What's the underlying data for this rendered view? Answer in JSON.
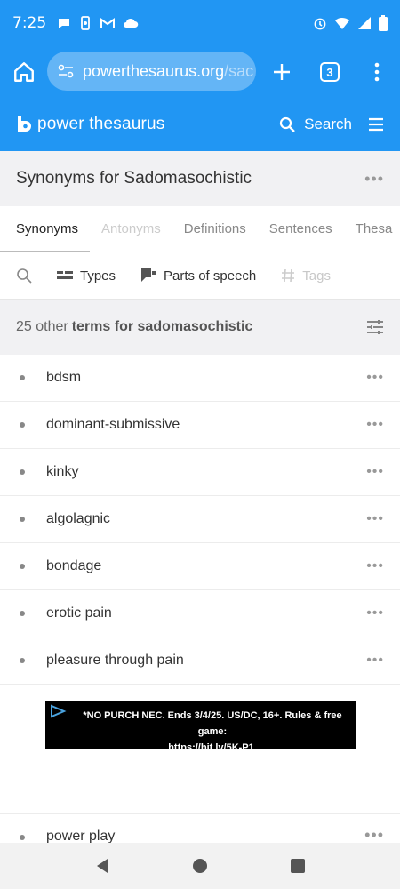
{
  "status_bar": {
    "time": "7:25",
    "left_icons": [
      "chat-bubble-icon",
      "phone-sync-icon",
      "gmail-icon",
      "cloud-icon"
    ],
    "right_icons": [
      "alarm-icon",
      "wifi-icon",
      "signal-icon",
      "battery-icon"
    ]
  },
  "browser": {
    "url_domain": "powerthesaurus.org",
    "url_path": "/sac",
    "tab_count": "3"
  },
  "site": {
    "logo_text": "power thesaurus",
    "search_label": "Search"
  },
  "page": {
    "title": "Synonyms for Sadomasochistic"
  },
  "tabs": [
    {
      "label": "Synonyms",
      "state": "active"
    },
    {
      "label": "Antonyms",
      "state": "disabled"
    },
    {
      "label": "Definitions",
      "state": "normal"
    },
    {
      "label": "Sentences",
      "state": "normal"
    },
    {
      "label": "Thesa",
      "state": "normal"
    }
  ],
  "filters": {
    "types_label": "Types",
    "parts_of_speech_label": "Parts of speech",
    "tags_label": "Tags"
  },
  "results": {
    "count_prefix": "25 other",
    "count_terms": "terms for sadomasochistic"
  },
  "terms": [
    "bdsm",
    "dominant-submissive",
    "kinky",
    "algolagnic",
    "bondage",
    "erotic pain",
    "pleasure through pain"
  ],
  "ad": {
    "line1": "*NO PURCH NEC. Ends 3/4/25. US/DC, 16+. Rules & free game:",
    "line2": "https://bit.ly/5K-P1."
  },
  "partial_term": "power play",
  "colors": {
    "brand_blue": "#2196f3",
    "band_gray": "#f1f1f3"
  }
}
